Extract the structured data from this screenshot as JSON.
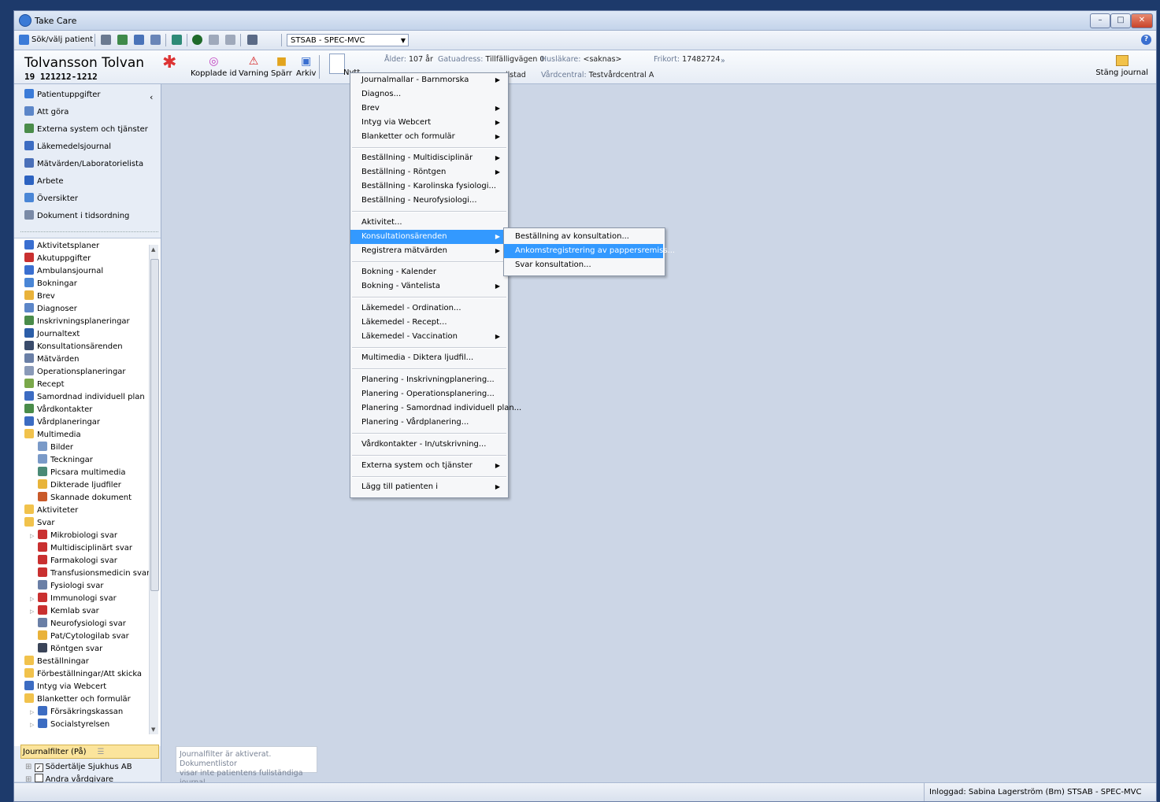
{
  "window": {
    "title": "Take Care"
  },
  "toolbar": {
    "search_patient": "Sök/välj patient",
    "unit": "STSAB - SPEC-MVC"
  },
  "patient": {
    "name": "Tolvansson Tolvan",
    "personnummer": "19 121212-1212",
    "buttons": {
      "kopplade_id": "Kopplade id",
      "varning": "Varning",
      "sparr": "Spärr",
      "arkiv": "Arkiv",
      "nytt": "Nytt"
    },
    "info": {
      "alder_label": "Ålder:",
      "alder": "107 år",
      "gatuadress_label": "Gatuadress:",
      "gatuadress": "Tillfälligvägen 0",
      "huslakare_label": "Husläkare:",
      "huslakare": "<saknas>",
      "frikort_label": "Frikort:",
      "frikort": "17482724",
      "ort": "llstad",
      "vardcentral_label": "Vårdcentral:",
      "vardcentral": "Testvårdcentral A"
    },
    "close_journal": "Stäng journal"
  },
  "sidebar": {
    "items": [
      "Patientuppgifter",
      "Att göra",
      "Externa system och tjänster",
      "Läkemedelsjournal",
      "Mätvärden/Laboratorielista",
      "Arbete",
      "Översikter",
      "Dokument i tidsordning"
    ],
    "tree": [
      "Aktivitetsplaner",
      "Akutuppgifter",
      "Ambulansjournal",
      "Bokningar",
      "Brev",
      "Diagnoser",
      "Inskrivningsplaneringar",
      "Journaltext",
      "Konsultationsärenden",
      "Mätvärden",
      "Operationsplaneringar",
      "Recept",
      "Samordnad individuell plan",
      "Vårdkontakter",
      "Vårdplaneringar",
      "Multimedia",
      "Bilder",
      "Teckningar",
      "Picsara multimedia",
      "Dikterade ljudfiler",
      "Skannade dokument",
      "Aktiviteter",
      "Svar",
      "Mikrobiologi svar",
      "Multidisciplinärt svar",
      "Farmakologi svar",
      "Transfusionsmedicin svar",
      "Fysiologi svar",
      "Immunologi svar",
      "Kemlab svar",
      "Neurofysiologi svar",
      "Pat/Cytologilab svar",
      "Röntgen svar",
      "Beställningar",
      "Förbeställningar/Att skicka",
      "Intyg via Webcert",
      "Blanketter och formulär",
      "Försäkringskassan",
      "Socialstyrelsen"
    ],
    "journal_filter": "Journalfilter (På)",
    "filter_tree": [
      "Södertälje Sjukhus AB",
      "Andra vårdgivare"
    ]
  },
  "tooltip": {
    "line1": "Journalfilter är aktiverat. Dokumentlistor",
    "line2": "visar inte patientens fullständiga journal."
  },
  "menu": {
    "items": [
      "Journalmallar - Barnmorska",
      "Diagnos...",
      "Brev",
      "Intyg via Webcert",
      "Blanketter och formulär",
      "Beställning - Multidisciplinär",
      "Beställning - Röntgen",
      "Beställning - Karolinska fysiologi...",
      "Beställning - Neurofysiologi...",
      "Aktivitet...",
      "Konsultationsärenden",
      "Registrera mätvärden",
      "Bokning - Kalender",
      "Bokning - Väntelista",
      "Läkemedel - Ordination...",
      "Läkemedel - Recept...",
      "Läkemedel - Vaccination",
      "Multimedia - Diktera ljudfil...",
      "Planering - Inskrivningplanering...",
      "Planering - Operationsplanering...",
      "Planering - Samordnad individuell plan...",
      "Planering - Vårdplanering...",
      "Vårdkontakter - In/utskrivning...",
      "Externa system och tjänster",
      "Lägg till patienten i"
    ],
    "submenu": [
      "Beställning av konsultation...",
      "Ankomstregistrering av pappersremiss...",
      "Svar konsultation..."
    ]
  },
  "status": {
    "logged_in": "Inloggad:  Sabina Lagerström (Bm) STSAB - SPEC-MVC"
  }
}
